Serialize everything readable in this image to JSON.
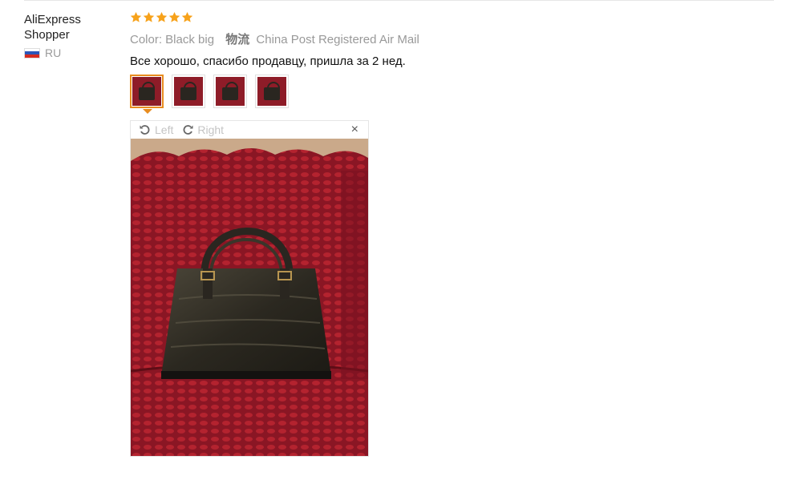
{
  "buyer": {
    "name_line1": "AliExpress",
    "name_line2": "Shopper",
    "country": "RU"
  },
  "review": {
    "rating": 5,
    "color_text": "Color: Black big",
    "logistics_label": "物流",
    "logistics_value": "China Post Registered Air Mail",
    "feedback": "Все хорошо, спасибо продавцу, пришла за 2 нед."
  },
  "viewer": {
    "rotate_left": "Left",
    "rotate_right": "Right",
    "close_symbol": "×"
  },
  "colors": {
    "star": "#f7a21b",
    "thumb_active_border": "#e88c1f"
  },
  "icons": [
    "star-icon",
    "flag-ru-icon",
    "rotate-left-icon",
    "rotate-right-icon",
    "close-icon"
  ]
}
